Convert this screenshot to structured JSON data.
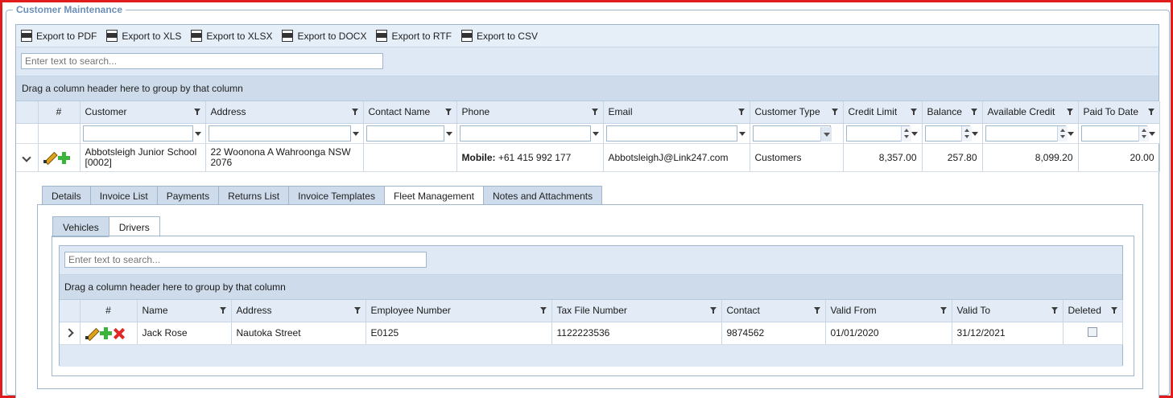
{
  "section_title": "Customer Maintenance",
  "toolbar": {
    "exports": [
      {
        "label": "Export to PDF",
        "icon": "pdf-icon"
      },
      {
        "label": "Export to XLS",
        "icon": "xls-icon"
      },
      {
        "label": "Export to XLSX",
        "icon": "xlsx-icon"
      },
      {
        "label": "Export to DOCX",
        "icon": "docx-icon"
      },
      {
        "label": "Export to RTF",
        "icon": "rtf-icon"
      },
      {
        "label": "Export to CSV",
        "icon": "csv-icon"
      }
    ]
  },
  "search": {
    "placeholder": "Enter text to search..."
  },
  "group_panel": "Drag a column header here to group by that column",
  "columns": [
    "#",
    "Customer",
    "Address",
    "Contact Name",
    "Phone",
    "Email",
    "Customer Type",
    "Credit Limit",
    "Balance",
    "Available Credit",
    "Paid To Date"
  ],
  "row": {
    "customer": "Abbotsleigh Junior School [0002]",
    "address": "22 Woonona A Wahroonga NSW 2076",
    "contact_name": "",
    "phone_label": "Mobile:",
    "phone": "+61 415 992 177",
    "email": "AbbotsleighJ@Link247.com",
    "customer_type": "Customers",
    "credit_limit": "8,357.00",
    "balance": "257.80",
    "available_credit": "8,099.20",
    "paid_to_date": "20.00"
  },
  "detail_tabs": [
    "Details",
    "Invoice List",
    "Payments",
    "Returns List",
    "Invoice Templates",
    "Fleet Management",
    "Notes and Attachments"
  ],
  "active_detail_tab": "Fleet Management",
  "sub_tabs": [
    "Vehicles",
    "Drivers"
  ],
  "active_sub_tab": "Drivers",
  "drivers": {
    "search_placeholder": "Enter text to search...",
    "group_panel": "Drag a column header here to group by that column",
    "columns": [
      "#",
      "Name",
      "Address",
      "Employee Number",
      "Tax File Number",
      "Contact",
      "Valid From",
      "Valid To",
      "Deleted"
    ],
    "row": {
      "name": "Jack Rose",
      "address": "Nautoka Street",
      "employee_number": "E0125",
      "tax_file_number": "1122223536",
      "contact": "9874562",
      "valid_from": "01/01/2020",
      "valid_to": "31/12/2021",
      "deleted": false
    }
  }
}
